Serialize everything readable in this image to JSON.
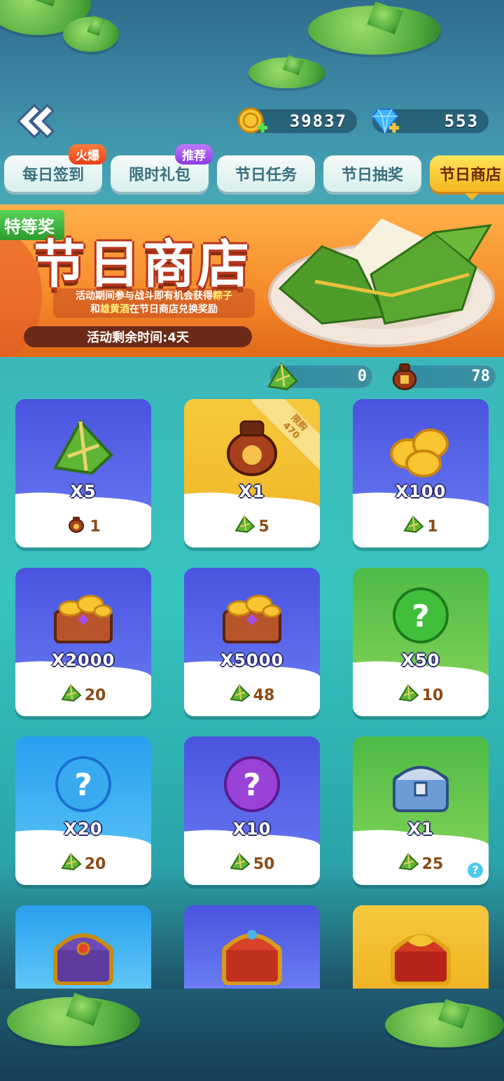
{
  "currency": {
    "coins": "39837",
    "gems": "553"
  },
  "tabs": [
    {
      "label": "每日签到",
      "badge": "火爆"
    },
    {
      "label": "限时礼包",
      "badge": "推荐"
    },
    {
      "label": "节日任务",
      "badge": ""
    },
    {
      "label": "节日抽奖",
      "badge": ""
    },
    {
      "label": "节日商店",
      "badge": ""
    }
  ],
  "active_tab": "节日商店",
  "banner": {
    "flag": "特等奖",
    "title": "节日商店",
    "desc_pre": "活动期间参与战斗即有机会获得",
    "desc_hl1": "粽子",
    "desc_mid": "和",
    "desc_hl2": "雄黄酒",
    "desc_post": "在节日商店兑换奖励",
    "timer": "活动剩余时间:4天"
  },
  "owned": {
    "zongzi": "0",
    "wine": "78"
  },
  "shop_items": [
    {
      "qty": "X5",
      "price": "1",
      "price_icon": "wine-icon",
      "item_icon": "zongzi-icon",
      "color": "blue"
    },
    {
      "qty": "X1",
      "price": "5",
      "price_icon": "zongzi-icon",
      "item_icon": "wine-jar-icon",
      "color": "gold",
      "limit": "限购",
      "limit_count": "470"
    },
    {
      "qty": "X100",
      "price": "1",
      "price_icon": "zongzi-icon",
      "item_icon": "coin-pile-icon",
      "color": "blue"
    },
    {
      "qty": "X2000",
      "price": "20",
      "price_icon": "zongzi-icon",
      "item_icon": "coin-chest-icon",
      "color": "blue"
    },
    {
      "qty": "X5000",
      "price": "48",
      "price_icon": "zongzi-icon",
      "item_icon": "coin-chest-icon",
      "color": "blue"
    },
    {
      "qty": "X50",
      "price": "10",
      "price_icon": "zongzi-icon",
      "item_icon": "green-mystery-orb-icon",
      "color": "green"
    },
    {
      "qty": "X20",
      "price": "20",
      "price_icon": "zongzi-icon",
      "item_icon": "blue-mystery-orb-icon",
      "color": "sky"
    },
    {
      "qty": "X10",
      "price": "50",
      "price_icon": "zongzi-icon",
      "item_icon": "purple-mystery-orb-icon",
      "color": "blue"
    },
    {
      "qty": "X1",
      "price": "25",
      "price_icon": "zongzi-icon",
      "item_icon": "silver-chest-icon",
      "color": "green",
      "help": "?"
    },
    {
      "item_icon": "purple-gold-chest-icon",
      "color": "sky"
    },
    {
      "item_icon": "red-gold-chest-icon",
      "color": "blue"
    },
    {
      "item_icon": "dragon-chest-icon",
      "color": "gold"
    }
  ]
}
